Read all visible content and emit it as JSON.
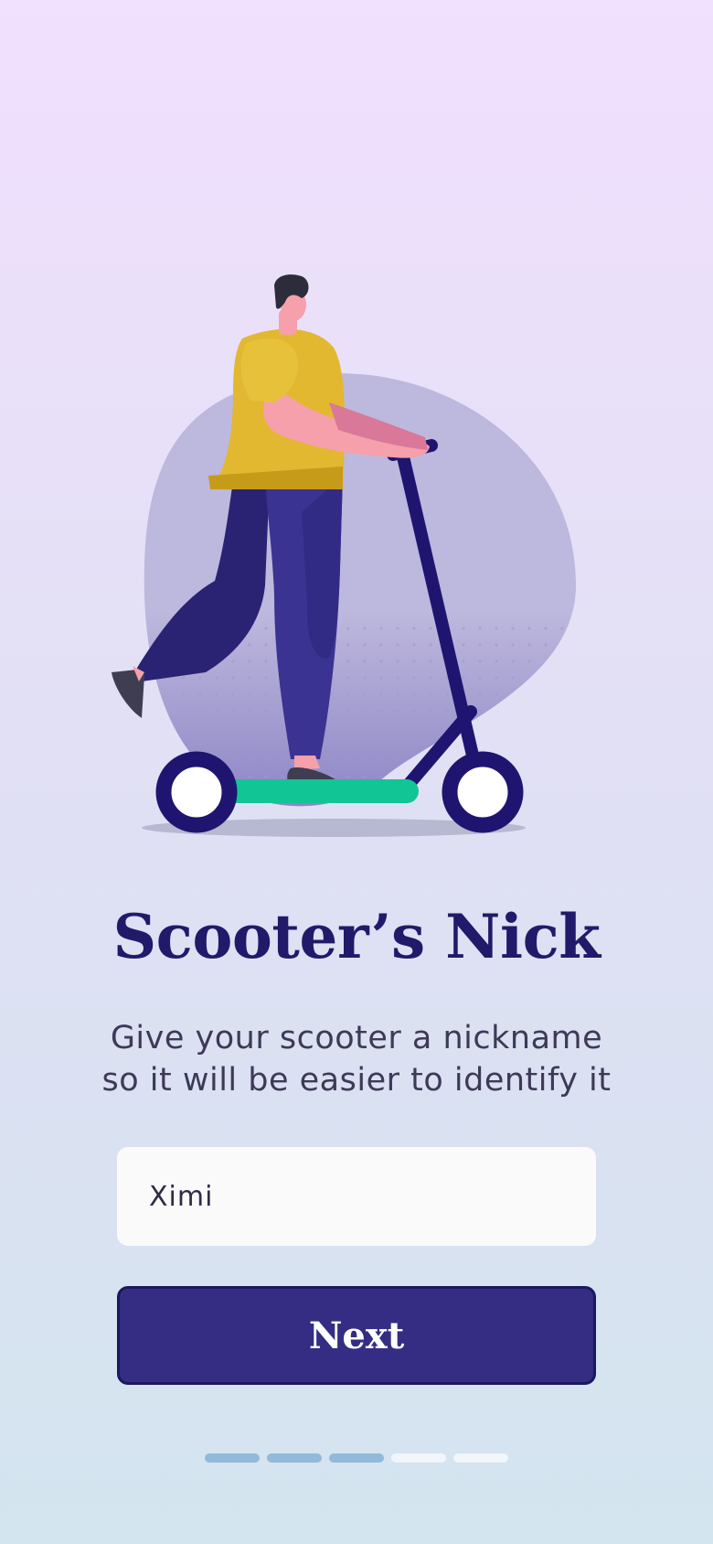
{
  "screen": {
    "title": "Scooter’s Nick",
    "subtitle_line1": "Give your scooter a nickname",
    "subtitle_line2": "so it will be easier to identify it"
  },
  "name_field": {
    "value": "Ximi"
  },
  "next_button": {
    "label": "Next"
  },
  "progress": {
    "total_steps": 5,
    "completed_steps": 3,
    "active_color": "#93b9d8",
    "inactive_color": "#f2f5f9"
  },
  "illustration": {
    "subject": "person-riding-scooter",
    "colors": {
      "blob": "#bdb8dd",
      "shirt": "#e2b830",
      "pants": "#3b3392",
      "scooter": "#1f1570",
      "deck": "#11c594",
      "skin": "#f5a0ab"
    }
  }
}
